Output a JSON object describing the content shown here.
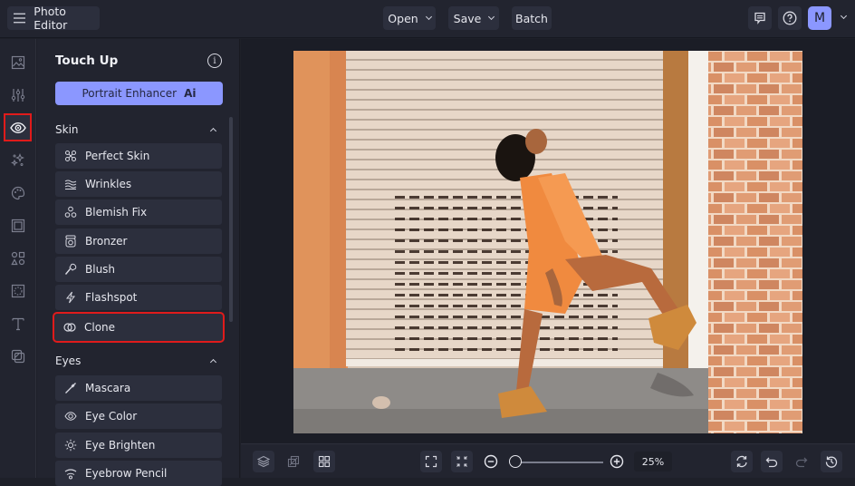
{
  "topbar": {
    "app_title": "Photo Editor",
    "open_label": "Open",
    "save_label": "Save",
    "batch_label": "Batch",
    "avatar_initial": "M"
  },
  "strip": {
    "icons": [
      "image-icon",
      "adjustments-icon",
      "eye-icon",
      "effects-icon",
      "artsy-icon",
      "frames-icon",
      "graphics-icon",
      "textures-icon",
      "text-icon",
      "overlays-icon"
    ],
    "active": "eye-icon"
  },
  "panel": {
    "title": "Touch Up",
    "portrait_enhancer_label": "Portrait Enhancer",
    "ai_badge": "Ai",
    "sections": [
      {
        "label": "Skin",
        "items": [
          "Perfect Skin",
          "Wrinkles",
          "Blemish Fix",
          "Bronzer",
          "Blush",
          "Flashspot",
          "Clone"
        ]
      },
      {
        "label": "Eyes",
        "items": [
          "Mascara",
          "Eye Color",
          "Eye Brighten",
          "Eyebrow Pencil"
        ]
      }
    ],
    "highlighted_item": "Clone"
  },
  "canvas": {
    "image_description": "Woman in orange dress and tan boots leaning against a roll-up garage door next to a brick wall"
  },
  "bottombar": {
    "zoom_value": "25%",
    "zoom_slider_fraction": 0.0
  },
  "colors": {
    "accent": "#8b97ff",
    "highlight": "#e01b1b",
    "bg": "#1e2029",
    "panel": "#22242f",
    "item": "#2c2f3d"
  }
}
